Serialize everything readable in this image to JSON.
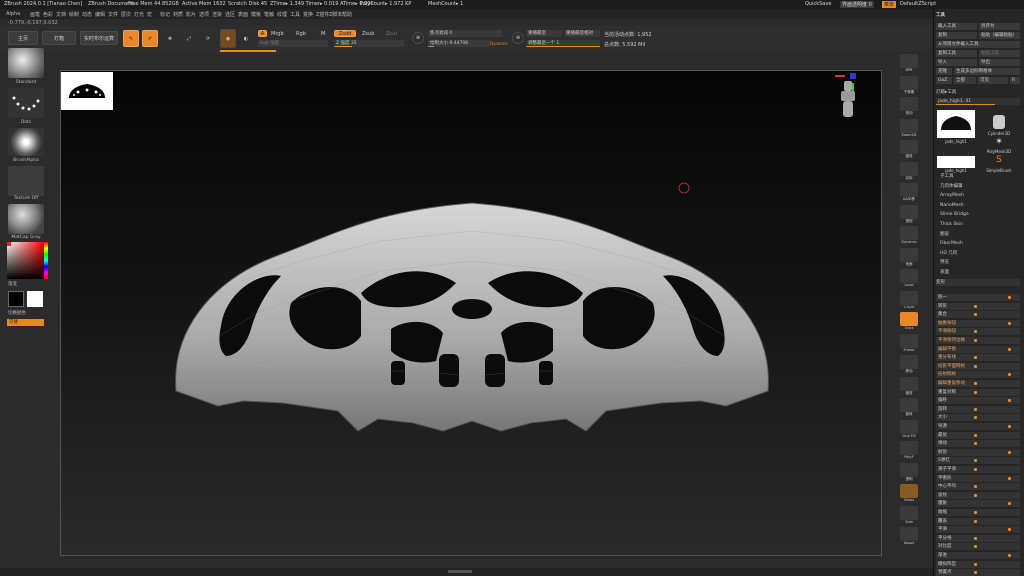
{
  "title": {
    "app": "ZBrush 2024.0.1 [Tianao Chen]",
    "doc": "ZBrush Document",
    "free_mem": "Free Mem 44.852GB",
    "active_mem": "Active Mem 1632",
    "scratch": "Scratch Disk 45",
    "ztime": "ZTime▸ 1.349 Timer▸ 0.019 ATime▸ 0.006",
    "polycount": "PolyCount▸ 1.972 KP",
    "meshcount": "MeshCount▸ 1",
    "quicksave": "QuickSave",
    "transparency": "界面透明度 0",
    "menu_btn": "菜单",
    "script": "DefaultZScript"
  },
  "menu": [
    "Alpha",
    "画笔",
    "色彩",
    "文档",
    "绘制",
    "动态",
    "编辑",
    "文件",
    "层次",
    "灯光",
    "宏",
    "标记",
    "材质",
    "影片",
    "选项",
    "渲染",
    "选区",
    "表面",
    "模板",
    "笔触",
    "纹理",
    "工具",
    "变换",
    "Z插件",
    "Z脚本",
    "帮助"
  ],
  "coords": "-0.779,-0.197,0.032",
  "toolbar": {
    "home": "主页",
    "lightbox": "灯箱",
    "live_boolean": "实时布尔运算",
    "edit": "Edit",
    "draw": "Draw",
    "move": "Move",
    "scale": "Scale",
    "rotate": "Rotate",
    "a_label": "A",
    "mrgb": "Mrgb",
    "rgb": "Rgb",
    "m": "M",
    "zadd": "Zadd",
    "zsub": "Zsub",
    "zcut": "Zcut",
    "rgb_strength": "Rgb 强度",
    "z_intensity": "Z 强度 25",
    "focal_shift": "焦点衰减 0",
    "draw_size": "绘制大小 9.44708",
    "dynamic": "Dynamic",
    "replay_last": "重播最后",
    "replay_last_rel": "重播最后相对",
    "adjust_last": "调整最后一个 1",
    "active_points": "当前活动点数: 1,952",
    "total_points": "总点数: 5.592 Mil"
  },
  "left": {
    "brush": "Standard",
    "stroke": "Dots",
    "alpha": "BrushAlpha",
    "texture": "Texture Off",
    "material": "MatCap Gray",
    "gradient": "渐变",
    "switch_color": "切换颜色",
    "alternate": "交替"
  },
  "rightstrip": [
    "BPR",
    "子像素",
    "滚动",
    "Zoom2D",
    "缩放",
    "实际",
    "AA半移",
    "透视",
    "Dynamic",
    "地面",
    "Local",
    "L.Sym",
    "Gxyz",
    "Frame",
    "移动",
    "缩放",
    "旋转",
    "Line Fill",
    "PolyF",
    "透明",
    "Ghost",
    "Solo",
    "Xpose"
  ],
  "toolpanel": {
    "header": "工具",
    "load": "载入工具",
    "save_as": "另存为",
    "copy": "复制",
    "paste": "粘贴（编辑粘贴）",
    "from_project": "从项目文件载入工具",
    "copy_tool": "复制工具",
    "paste_tool": "粘贴工具",
    "import": "导入",
    "export": "导出",
    "clone": "克隆",
    "make_polymesh": "生成多边形网格体",
    "goz": "GoZ",
    "all": "全部",
    "visible": "可见",
    "r": "R",
    "lightbox_tools": "灯箱▸工具",
    "current_tool": "jade_high1. 41",
    "thumbs": [
      "jade_high1",
      "Cylinder3D",
      "PolyMesh3D",
      "jade_high1",
      "SimpleBrush"
    ],
    "sub_sections": [
      "子工具",
      "几何体编辑",
      "ArrayMesh",
      "NanoMesh",
      "Slime Bridge",
      "Thick Skin",
      "图层",
      "FiberMesh",
      "HD 几何",
      "预览",
      "表面",
      "变形"
    ],
    "deform": [
      "统一",
      "转形",
      "集合",
      "抽象按钮",
      "平滑按钮",
      "平滑保持边缘",
      "编辑平衡",
      "重分布线",
      "投影平面网格",
      "投射网格",
      "编辑重复移动",
      "重复对称",
      "偏移",
      "旋转",
      "大小",
      "导源",
      "最优",
      "弹动",
      "射验",
      "S弹红",
      "滑子平滑",
      "平衡形",
      "中心平均",
      "波纹",
      "膜胀",
      "收缩",
      "覆盖",
      "平滑",
      "平分线",
      "对比度",
      "渐进",
      "模拟阵型",
      "预置点"
    ]
  },
  "colors": {
    "accent": "#e8882a",
    "bg": "#2b2b2b",
    "viewport_top": "#050505"
  }
}
